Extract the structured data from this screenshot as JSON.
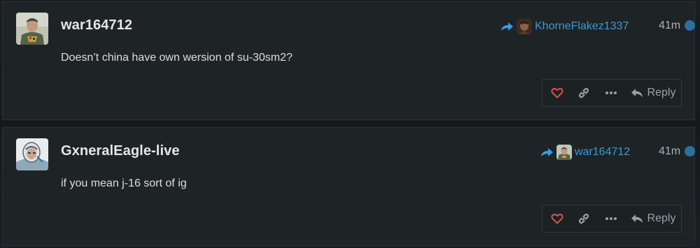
{
  "posts": [
    {
      "username": "war164712",
      "body": "Doesn’t china have own wersion of su-30sm2?",
      "reply_to": "KhorneFlakez1337",
      "time": "41m",
      "reply_label": "Reply"
    },
    {
      "username": "GxneralEagle-live",
      "body": "if you mean j-16 sort of ig",
      "reply_to": "war164712",
      "time": "41m",
      "reply_label": "Reply"
    }
  ],
  "colors": {
    "accent": "#3a9ad9",
    "heart": "#d9534f",
    "unread_dot": "#2e6f9b"
  },
  "icons": [
    "reply-arrow-icon",
    "heart-icon",
    "link-icon",
    "ellipsis-icon",
    "reply-icon"
  ]
}
